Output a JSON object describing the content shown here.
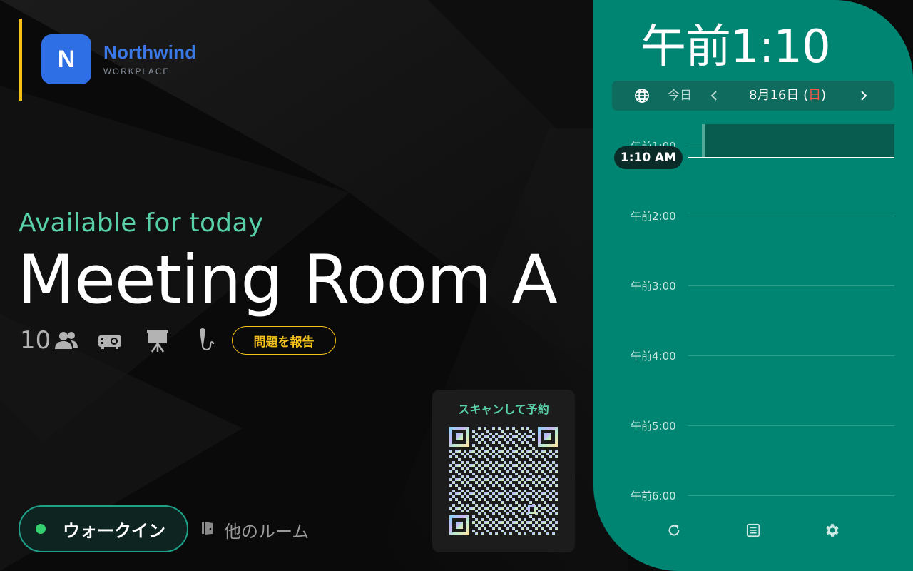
{
  "brand": {
    "initial": "N",
    "name": "Northwind",
    "subtitle": "WORKPLACE"
  },
  "room": {
    "status": "Available for today",
    "name": "Meeting Room A",
    "capacity": "10",
    "amenities": [
      "people-icon",
      "projector-icon",
      "whiteboard-icon",
      "microphone-icon"
    ],
    "report_label": "問題を報告"
  },
  "actions": {
    "walkin_label": "ウォークイン",
    "other_rooms_label": "他のルーム"
  },
  "qr": {
    "title": "スキャンして予約"
  },
  "schedule": {
    "clock": "午前1:10",
    "today_label": "今日",
    "date_label": "8月16日 (",
    "date_day": "日",
    "date_close": ")",
    "now_label": "1:10 AM",
    "hours": [
      "午前1:00",
      "午前2:00",
      "午前3:00",
      "午前4:00",
      "午前5:00",
      "午前6:00"
    ]
  },
  "colors": {
    "accent_green": "#58d0a8",
    "panel_teal": "#008573",
    "brand_blue": "#2f6fe6",
    "warning_yellow": "#f4c21b",
    "sunday_red": "#ff5a48"
  }
}
